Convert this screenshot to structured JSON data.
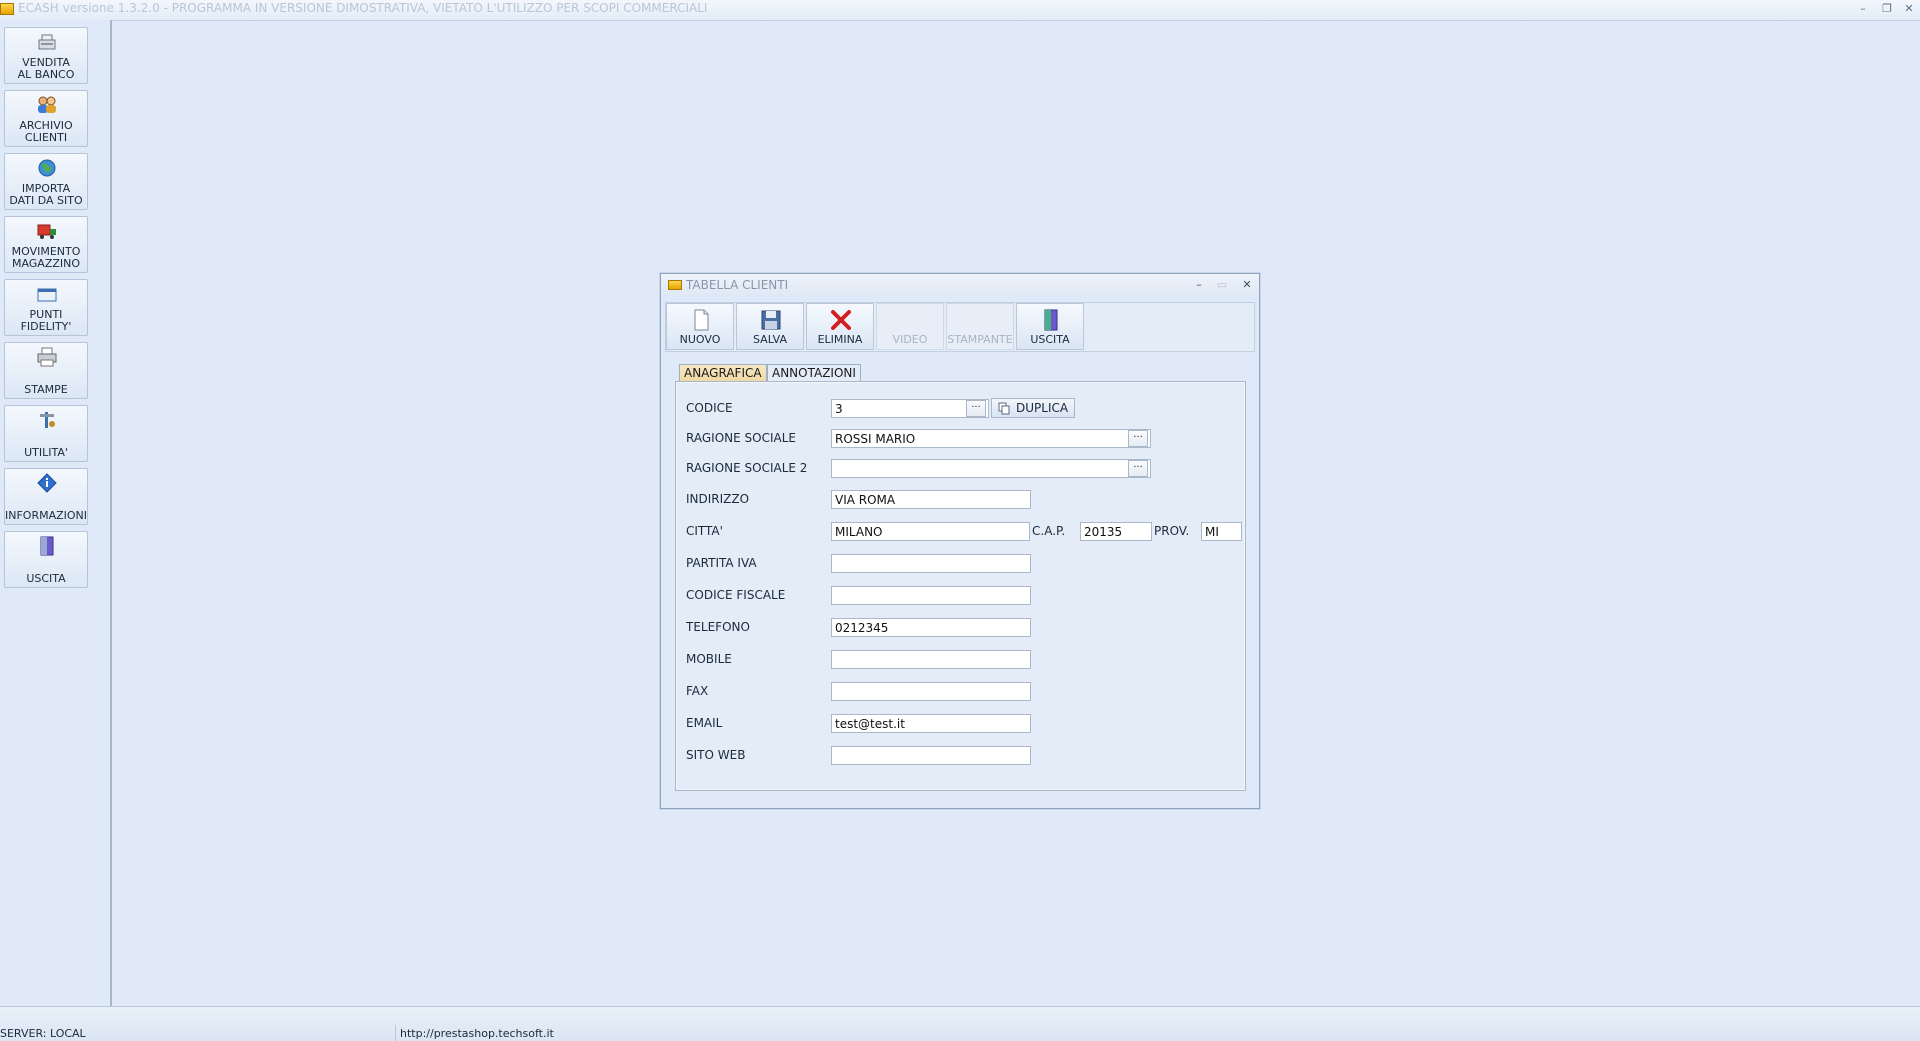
{
  "window": {
    "title": "ECASH versione 1.3.2.0 - PROGRAMMA IN VERSIONE DIMOSTRATIVA, VIETATO L'UTILIZZO PER SCOPI COMMERCIALI",
    "controls": {
      "minimize": "–",
      "restore": "❐",
      "close": "✕"
    }
  },
  "sidebar": {
    "items": [
      {
        "label": "VENDITA\nAL BANCO",
        "icon": "cash-register-icon"
      },
      {
        "label": "ARCHIVIO\nCLIENTI",
        "icon": "people-icon"
      },
      {
        "label": "IMPORTA\nDATI DA SITO",
        "icon": "globe-icon"
      },
      {
        "label": "MOVIMENTO\nMAGAZZINO",
        "icon": "truck-icon"
      },
      {
        "label": "PUNTI\nFIDELITY'",
        "icon": "card-icon"
      },
      {
        "label": "STAMPE",
        "icon": "printer-icon"
      },
      {
        "label": "UTILITA'",
        "icon": "tools-icon"
      },
      {
        "label": "INFORMAZIONI",
        "icon": "info-icon"
      },
      {
        "label": "USCITA",
        "icon": "exit-door-icon"
      }
    ]
  },
  "dialog": {
    "title": "TABELLA CLIENTI",
    "controls": {
      "minimize": "–",
      "maximize": "▭",
      "close": "✕"
    },
    "toolbar": {
      "nuovo": "NUOVO",
      "salva": "SALVA",
      "elimina": "ELIMINA",
      "video": "VIDEO",
      "stampante": "STAMPANTE",
      "uscita": "USCITA"
    },
    "tabs": {
      "anagrafica": "ANAGRAFICA",
      "annotazioni": "ANNOTAZIONI"
    },
    "duplica_label": "DUPLICA",
    "ellipsis": "···",
    "fields": {
      "codice": {
        "label": "CODICE",
        "value": "3"
      },
      "ragione_sociale": {
        "label": "RAGIONE SOCIALE",
        "value": "ROSSI MARIO"
      },
      "ragione_sociale_2": {
        "label": "RAGIONE SOCIALE 2",
        "value": ""
      },
      "indirizzo": {
        "label": "INDIRIZZO",
        "value": "VIA ROMA"
      },
      "citta": {
        "label": "CITTA'",
        "value": "MILANO"
      },
      "cap": {
        "label": "C.A.P.",
        "value": "20135"
      },
      "prov": {
        "label": "PROV.",
        "value": "MI"
      },
      "partita_iva": {
        "label": "PARTITA IVA",
        "value": ""
      },
      "codice_fiscale": {
        "label": "CODICE FISCALE",
        "value": ""
      },
      "telefono": {
        "label": "TELEFONO",
        "value": "0212345"
      },
      "mobile": {
        "label": "MOBILE",
        "value": ""
      },
      "fax": {
        "label": "FAX",
        "value": ""
      },
      "email": {
        "label": "EMAIL",
        "value": "test@test.it"
      },
      "sito_web": {
        "label": "SITO WEB",
        "value": ""
      }
    }
  },
  "statusbar": {
    "server": "SERVER: LOCAL",
    "url": "http://prestashop.techsoft.it"
  }
}
